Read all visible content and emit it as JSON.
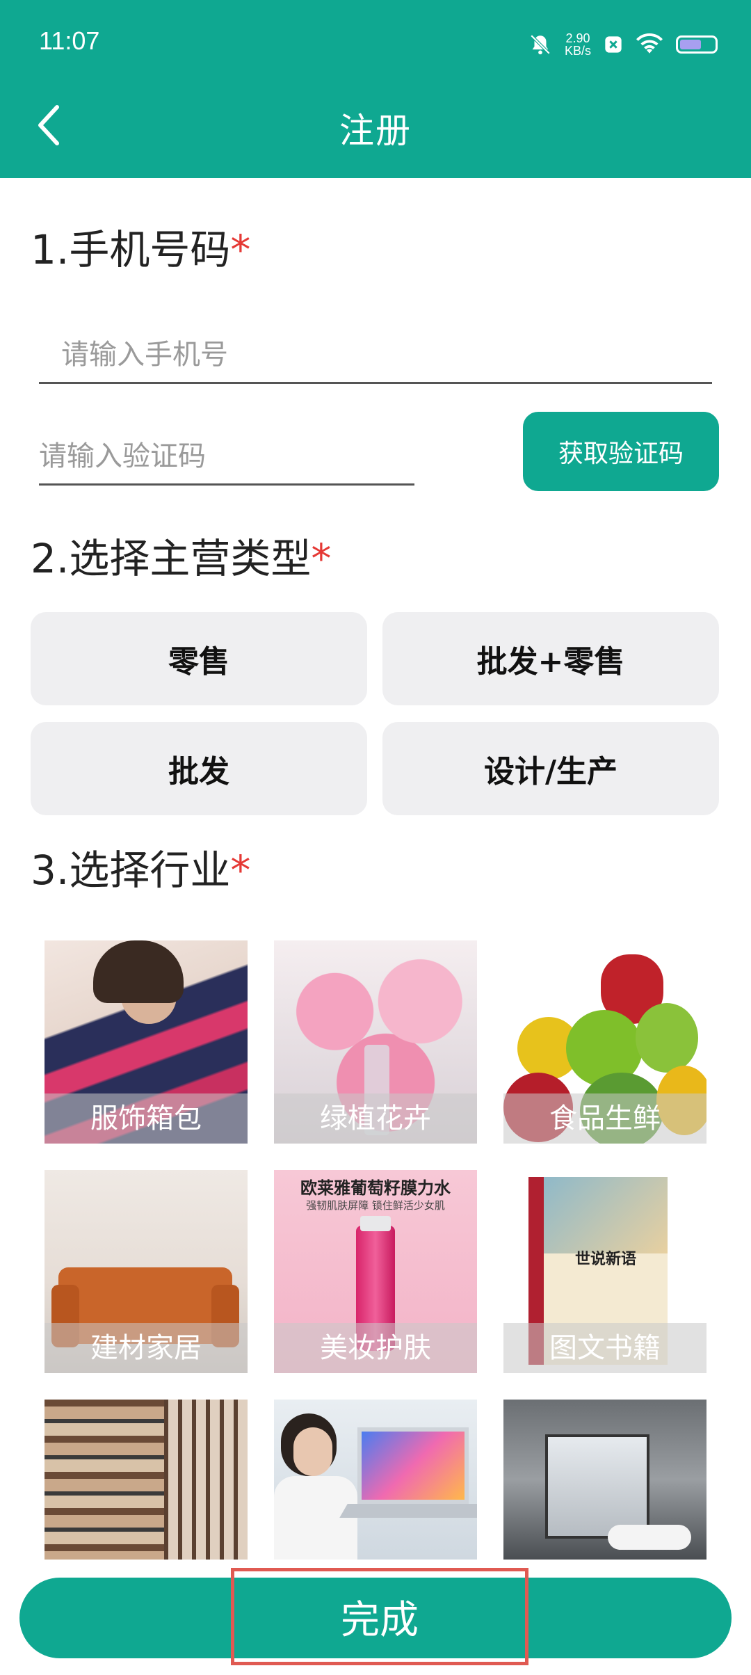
{
  "status_bar": {
    "time": "11:07",
    "net_speed_value": "2.90",
    "net_speed_unit": "KB/s"
  },
  "header": {
    "title": "注册"
  },
  "section1": {
    "title": "1.手机号码",
    "required_mark": "*",
    "phone_placeholder": "请输入手机号",
    "code_placeholder": "请输入验证码",
    "get_code_label": "获取验证码"
  },
  "section2": {
    "title": "2.选择主营类型",
    "required_mark": "*",
    "options": [
      "零售",
      "批发+零售",
      "批发",
      "设计/生产"
    ]
  },
  "section3": {
    "title": "3.选择行业",
    "required_mark": "*",
    "industries": [
      "服饰箱包",
      "绿植花卉",
      "食品生鲜",
      "建材家居",
      "美妆护肤",
      "图文书籍",
      "",
      "",
      ""
    ],
    "book_cover_title": "世说新语",
    "ad_headline": "欧莱雅葡萄籽膜力水",
    "ad_subline": "强韧肌肤屏障 锁住鲜活少女肌"
  },
  "footer": {
    "done_label": "完成"
  }
}
